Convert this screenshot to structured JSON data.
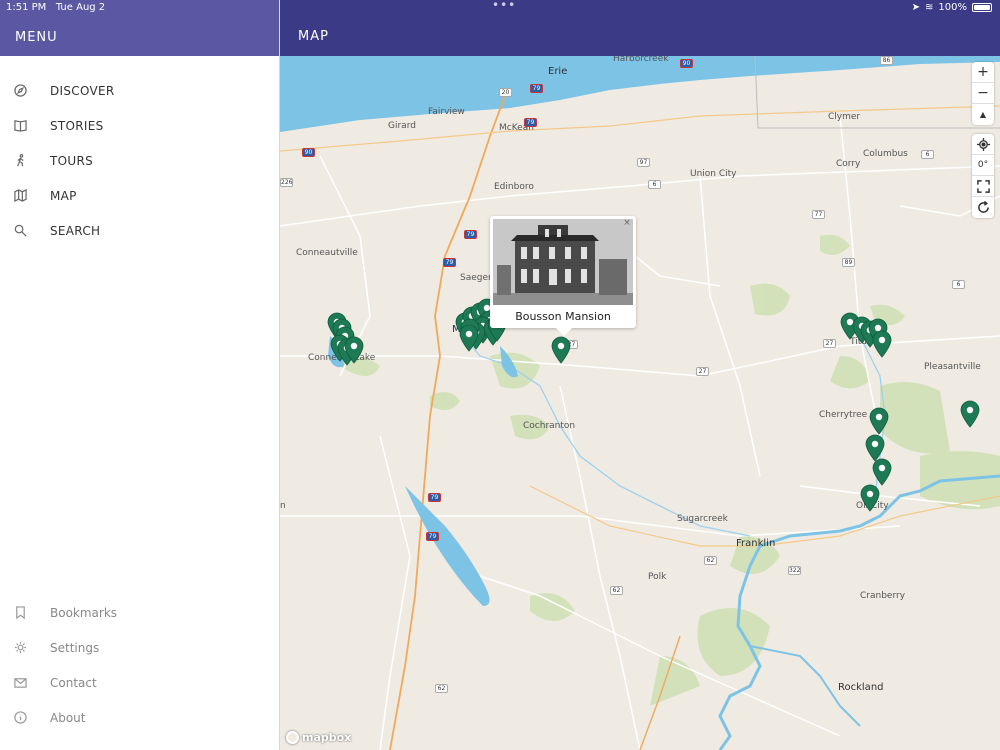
{
  "status": {
    "time": "1:51 PM",
    "date": "Tue Aug 2",
    "battery": "100%"
  },
  "sidebar": {
    "title": "MENU",
    "items": [
      {
        "label": "DISCOVER",
        "icon": "compass-icon"
      },
      {
        "label": "STORIES",
        "icon": "book-icon"
      },
      {
        "label": "TOURS",
        "icon": "walking-icon"
      },
      {
        "label": "MAP",
        "icon": "map-icon"
      },
      {
        "label": "SEARCH",
        "icon": "search-icon"
      }
    ],
    "footer": [
      {
        "label": "Bookmarks",
        "icon": "bookmark-icon"
      },
      {
        "label": "Settings",
        "icon": "gear-icon"
      },
      {
        "label": "Contact",
        "icon": "mail-icon"
      },
      {
        "label": "About",
        "icon": "info-icon"
      }
    ]
  },
  "map": {
    "title": "MAP",
    "popup": {
      "title": "Bousson Mansion",
      "close": "×"
    },
    "labels": {
      "erie": "Erie",
      "harborcreek": "Harborcreek",
      "fairview": "Fairview",
      "girard": "Girard",
      "mckean": "McKean",
      "edinboro": "Edinboro",
      "union_city": "Union City",
      "corry": "Corry",
      "clymer": "Clymer",
      "columbus": "Columbus",
      "conneautville": "Conneautville",
      "saegertown": "Saeger",
      "meadville": "M",
      "conneaut_lake": "Conneaut Lake",
      "titusville": "Titus",
      "pleasantville": "Pleasantville",
      "cherrytree": "Cherrytree",
      "oil_city": "Oil City",
      "cochranton": "Cochranton",
      "sugarcreek": "Sugarcreek",
      "franklin": "Franklin",
      "polk": "Polk",
      "cranberry": "Cranberry",
      "rockland": "Rockland",
      "n": "n"
    },
    "shields": [
      "86",
      "90",
      "20",
      "79",
      "97",
      "6",
      "90",
      "6",
      "226",
      "79",
      "77",
      "79",
      "89",
      "79",
      "27",
      "27",
      "27",
      "6",
      "79",
      "79",
      "62",
      "322",
      "62",
      "62"
    ],
    "controls": {
      "zoom_in": "+",
      "zoom_out": "−",
      "compass": "▲",
      "bearing": "0°"
    },
    "attribution": "mapbox"
  },
  "colors": {
    "menu_header": "#5b58a3",
    "map_header": "#3a3a86",
    "marker": "#1e7a55",
    "water": "#7cc3e6",
    "land": "#efebe3"
  }
}
